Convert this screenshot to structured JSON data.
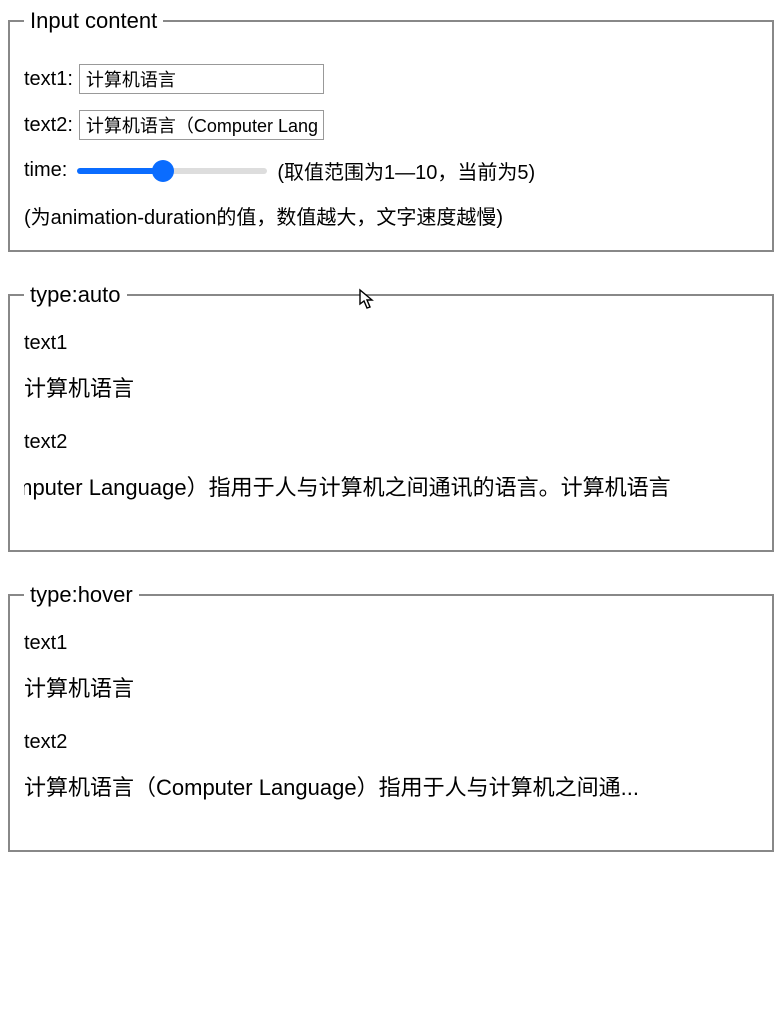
{
  "input_section": {
    "legend": "Input content",
    "text1_label": "text1:",
    "text1_value": "计算机语言",
    "text2_label": "text2:",
    "text2_value": "计算机语言（Computer Language）指用于人与计算机之间通讯的语言。计算机语言",
    "time_label": "time:",
    "time_min": "1",
    "time_max": "10",
    "time_value": "5",
    "time_range_note": "(取值范围为1—10，当前为5)",
    "time_desc": "(为animation-duration的值，数值越大，文字速度越慢)"
  },
  "auto_section": {
    "legend": "type:auto",
    "text1_label": "text1",
    "text1_display": "计算机语言",
    "text2_label": "text2",
    "text2_display": "计算机语言（Computer Language）指用于人与计算机之间通讯的语言。计算机语言"
  },
  "hover_section": {
    "legend": "type:hover",
    "text1_label": "text1",
    "text1_display": "计算机语言",
    "text2_label": "text2",
    "text2_display": "计算机语言（Computer Language）指用于人与计算机之间通..."
  }
}
